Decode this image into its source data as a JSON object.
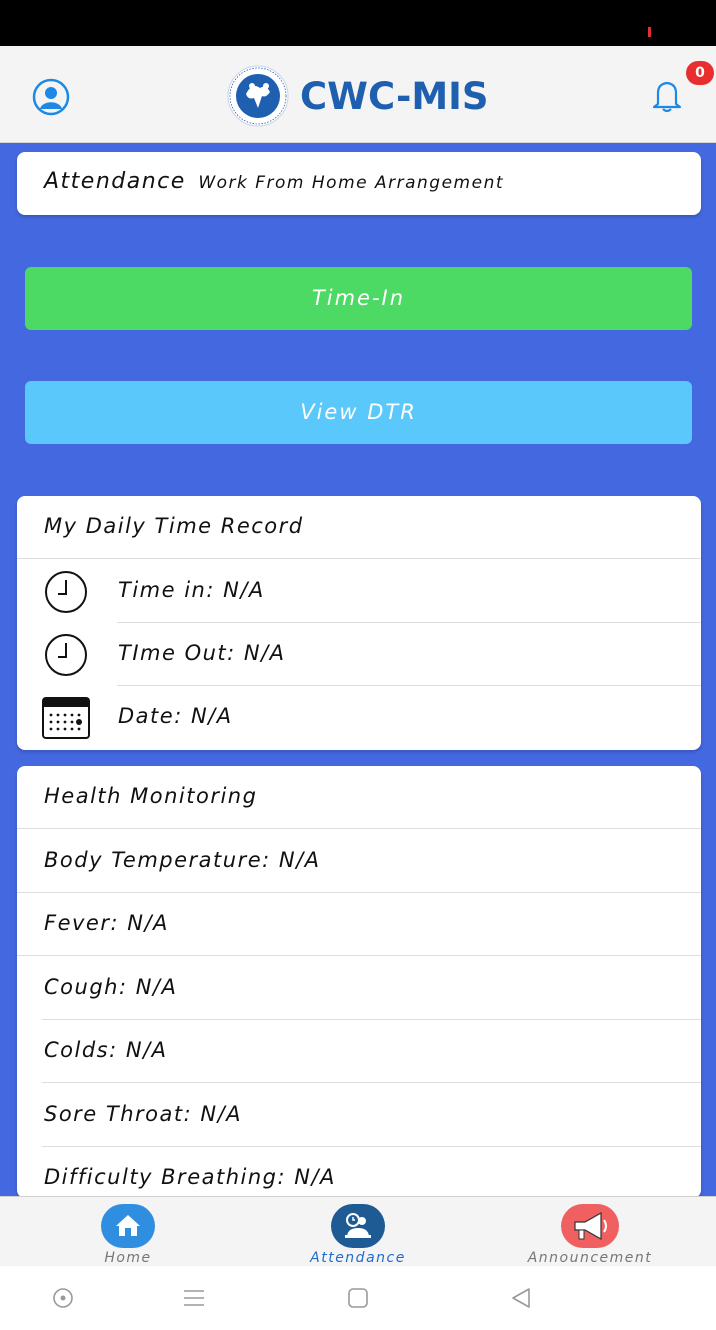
{
  "header": {
    "title": "CWC-MIS",
    "notification_count": "0"
  },
  "attendance_card": {
    "title": "Attendance",
    "subtitle": "Work From Home Arrangement"
  },
  "buttons": {
    "time_in": "Time-In",
    "view_dtr": "View DTR"
  },
  "dtr": {
    "title": "My Daily Time Record",
    "rows": [
      {
        "label": "Time in: N/A",
        "icon": "clock-icon"
      },
      {
        "label": "TIme Out: N/A",
        "icon": "clock-icon"
      },
      {
        "label": "Date: N/A",
        "icon": "calendar-icon"
      }
    ]
  },
  "health": {
    "title": "Health Monitoring",
    "rows": [
      "Body Temperature: N/A",
      "Fever: N/A",
      "Cough: N/A",
      "Colds: N/A",
      "Sore Throat: N/A",
      "Difficulty Breathing: N/A"
    ]
  },
  "bottom_nav": {
    "items": [
      {
        "label": "Home",
        "icon": "home-icon"
      },
      {
        "label": "Attendance",
        "icon": "attendance-icon",
        "active": true
      },
      {
        "label": "Announcement",
        "icon": "megaphone-icon"
      }
    ]
  },
  "colors": {
    "background": "#4468e0",
    "time_in_button": "#4cd964",
    "view_dtr_button": "#5ac8fa",
    "brand": "#1f5fb0",
    "badge": "#e82e2e"
  }
}
